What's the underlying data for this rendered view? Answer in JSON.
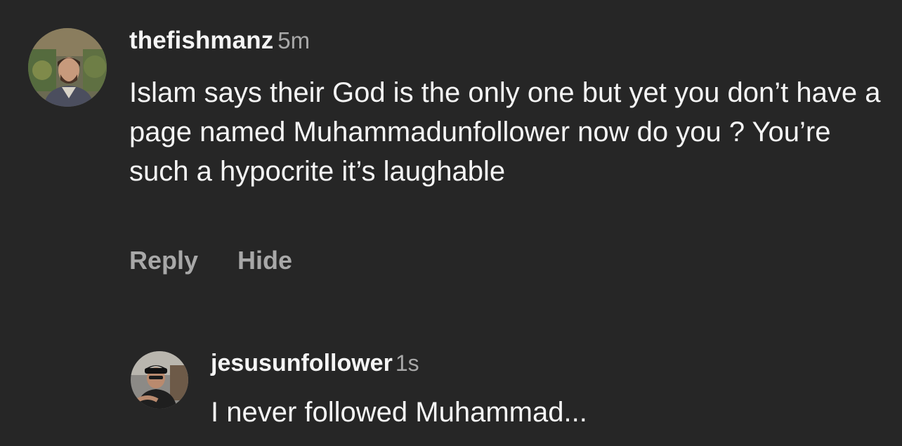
{
  "comments": [
    {
      "username": "thefishmanz",
      "time": "5m",
      "text": "Islam says their God is the only one but yet you don’t have a page named Muhammadunfollower now do you ? You’re such a hypocrite it’s laughable",
      "actions": {
        "reply": "Reply",
        "hide": "Hide"
      },
      "avatar_icon": "profile-photo"
    },
    {
      "username": "jesusunfollower",
      "time": "1s",
      "text": "I never followed Muhammad...",
      "avatar_icon": "profile-photo"
    }
  ],
  "colors": {
    "background": "#262626",
    "primary_text": "#f5f5f5",
    "secondary_text": "#a8a8a8"
  }
}
